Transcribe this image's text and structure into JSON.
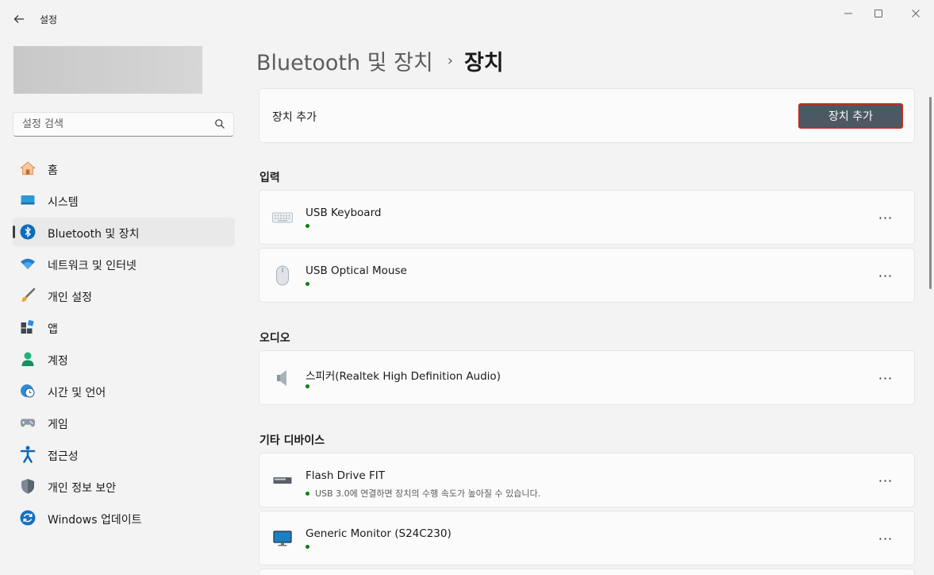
{
  "window": {
    "app_title": "설정",
    "back_icon": "arrow-left-icon",
    "controls": [
      "minimize-icon",
      "maximize-icon",
      "close-icon"
    ]
  },
  "sidebar": {
    "search_placeholder": "설정 검색",
    "items": [
      {
        "label": "홈",
        "icon": "home-icon"
      },
      {
        "label": "시스템",
        "icon": "system-monitor-icon"
      },
      {
        "label": "Bluetooth 및 장치",
        "icon": "bluetooth-icon",
        "active": true
      },
      {
        "label": "네트워크 및 인터넷",
        "icon": "wifi-icon"
      },
      {
        "label": "개인 설정",
        "icon": "paintbrush-icon"
      },
      {
        "label": "앱",
        "icon": "apps-icon"
      },
      {
        "label": "계정",
        "icon": "account-icon"
      },
      {
        "label": "시간 및 언어",
        "icon": "clock-globe-icon"
      },
      {
        "label": "게임",
        "icon": "gamepad-icon"
      },
      {
        "label": "접근성",
        "icon": "accessibility-icon"
      },
      {
        "label": "개인 정보 보안",
        "icon": "shield-icon"
      },
      {
        "label": "Windows 업데이트",
        "icon": "update-icon"
      }
    ]
  },
  "main": {
    "breadcrumb_parent": "Bluetooth 및 장치",
    "breadcrumb_sep": "›",
    "breadcrumb_current": "장치",
    "add_card": {
      "label": "장치 추가",
      "button": "장치 추가"
    },
    "sections": {
      "input": "입력",
      "audio": "오디오",
      "other": "기타 디바이스"
    },
    "devices": {
      "keyboard": {
        "name": "USB Keyboard",
        "icon": "keyboard-icon"
      },
      "mouse": {
        "name": "USB Optical Mouse",
        "icon": "mouse-icon"
      },
      "speaker": {
        "name": "스피커(Realtek High Definition Audio)",
        "icon": "speaker-icon"
      },
      "flash": {
        "name": "Flash Drive FIT",
        "status": "USB 3.0에 연결하면 장치의 수행 속도가 높아질 수 있습니다.",
        "icon": "usb-drive-icon"
      },
      "monitor": {
        "name": "Generic Monitor (S24C230)",
        "icon": "monitor-icon"
      }
    },
    "more_label": "···"
  },
  "colors": {
    "status_dot": "#107c10",
    "button_bg": "#4b5963",
    "button_focus_border": "#c42b1c",
    "accent_blue": "#0067c0"
  }
}
